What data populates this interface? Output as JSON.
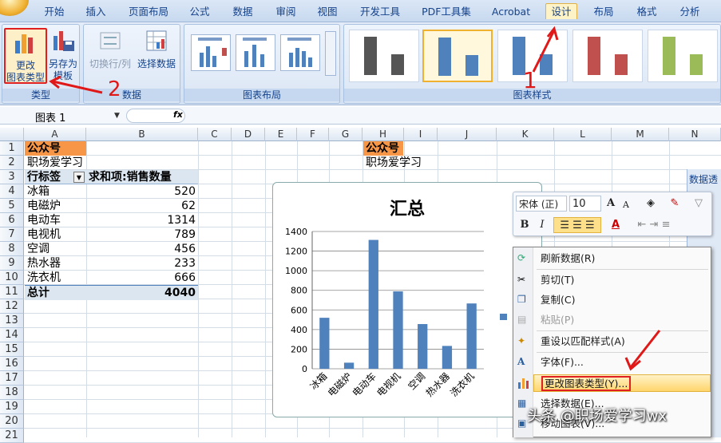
{
  "tabs": [
    "开始",
    "插入",
    "页面布局",
    "公式",
    "数据",
    "审阅",
    "视图",
    "开发工具",
    "PDF工具集",
    "Acrobat",
    "设计",
    "布局",
    "格式",
    "分析"
  ],
  "ribbon": {
    "type_group": {
      "label": "类型",
      "change_type": "更改\n图表类型",
      "change_type_l1": "更改",
      "change_type_l2": "图表类型",
      "save_template_l1": "另存为",
      "save_template_l2": "模板"
    },
    "data_group": {
      "label": "数据",
      "switch_row_col": "切换行/列",
      "select_data": "选择数据"
    },
    "layout_group": {
      "label": "图表布局"
    },
    "style_group": {
      "label": "图表样式"
    },
    "styles": [
      {
        "color": "#555555"
      },
      {
        "color": "#4f81bd"
      },
      {
        "color": "#4f81bd"
      },
      {
        "color": "#c0504d"
      },
      {
        "color": "#9bbb59"
      }
    ]
  },
  "annotations": {
    "one": "1",
    "two": "2"
  },
  "formula_bar": {
    "name_box": "图表 1",
    "fx": "fx"
  },
  "columns": [
    "A",
    "B",
    "C",
    "D",
    "E",
    "F",
    "G",
    "H",
    "I",
    "J",
    "K",
    "L",
    "M",
    "N"
  ],
  "rows": [
    "1",
    "2",
    "3",
    "4",
    "5",
    "6",
    "7",
    "8",
    "9",
    "10",
    "11",
    "12",
    "13",
    "14",
    "15",
    "16",
    "17",
    "18",
    "19",
    "20",
    "21"
  ],
  "sheet": {
    "a1": "公众号",
    "a2": "职场爱学习",
    "a3": "行标签",
    "b3": "求和项:销售数量",
    "h1": "公众号",
    "h2": "职场爱学习",
    "items": [
      {
        "name": "冰箱",
        "value": "520"
      },
      {
        "name": "电磁炉",
        "value": "62"
      },
      {
        "name": "电动车",
        "value": "1314"
      },
      {
        "name": "电视机",
        "value": "789"
      },
      {
        "name": "空调",
        "value": "456"
      },
      {
        "name": "热水器",
        "value": "233"
      },
      {
        "name": "洗衣机",
        "value": "666"
      }
    ],
    "total_label": "总计",
    "total_value": "4040"
  },
  "chart_data": {
    "type": "bar",
    "title": "汇总",
    "categories": [
      "冰箱",
      "电磁炉",
      "电动车",
      "电视机",
      "空调",
      "热水器",
      "洗衣机"
    ],
    "values": [
      520,
      62,
      1314,
      789,
      456,
      233,
      666
    ],
    "ylim": [
      0,
      1400
    ],
    "yticks": [
      "0",
      "200",
      "400",
      "600",
      "800",
      "1000",
      "1200",
      "1400"
    ],
    "color": "#4f81bd",
    "grid": true
  },
  "mini_toolbar": {
    "font": "宋体 (正)",
    "size": "10",
    "bold": "B",
    "italic": "I",
    "grow": "A",
    "shrink": "A",
    "fontcolor": "A"
  },
  "context_menu": {
    "refresh": "刷新数据(R)",
    "cut": "剪切(T)",
    "copy": "复制(C)",
    "paste": "粘贴(P)",
    "reset": "重设以匹配样式(A)",
    "font": "字体(F)...",
    "change_type": "更改图表类型(Y)...",
    "select_data": "选择数据(E)...",
    "move_chart": "移动图表(V)..."
  },
  "side_panel": {
    "title": "数据透"
  },
  "watermark": "头条 @职场爱学习wx"
}
